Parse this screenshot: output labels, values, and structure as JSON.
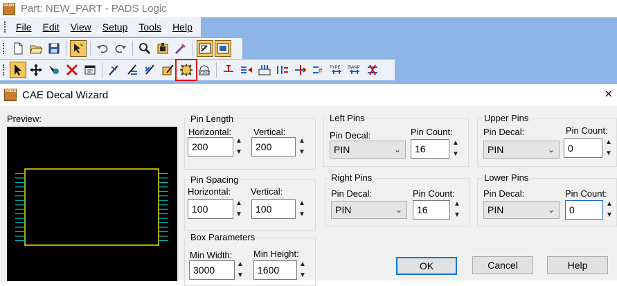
{
  "window": {
    "app_icon_text": "PADS",
    "title": "Part: NEW_PART - PADS Logic"
  },
  "menu": {
    "items": [
      "File",
      "Edit",
      "View",
      "Setup",
      "Tools",
      "Help"
    ]
  },
  "toolbar1": {
    "icons": [
      "new-icon",
      "open-icon",
      "save-icon",
      "select-mode-icon",
      "undo-icon",
      "redo-icon",
      "zoom-icon",
      "library-icon",
      "wizard-icon",
      "part-editor-icon",
      "gate-editor-icon"
    ]
  },
  "toolbar2": {
    "icons": [
      "select-arrow-icon",
      "move-icon",
      "rotate-icon",
      "delete-icon",
      "properties-icon",
      "add-2d-line-icon",
      "add-text-icon",
      "add-field-icon",
      "edit-part-icon",
      "cae-decal-wizard-icon",
      "add-cost-icon",
      "add-terminal-icon",
      "set-pin-numbers-icon",
      "renumber-icon",
      "pin-spacing-icon",
      "pin-type-icon",
      "type-icon",
      "swap-icon",
      "pin-swap-icon"
    ],
    "type_label": "TYPE",
    "swap_label": "SWAP"
  },
  "dialog": {
    "title": "CAE Decal Wizard",
    "close_glyph": "×",
    "preview_label": "Preview:",
    "pin_length": {
      "title": "Pin Length",
      "horizontal_label": "Horizontal:",
      "horizontal_value": "200",
      "vertical_label": "Vertical:",
      "vertical_value": "200"
    },
    "pin_spacing": {
      "title": "Pin Spacing",
      "horizontal_label": "Horizontal:",
      "horizontal_value": "100",
      "vertical_label": "Vertical:",
      "vertical_value": "100"
    },
    "box_parameters": {
      "title": "Box Parameters",
      "min_width_label": "Min Width:",
      "min_width_value": "3000",
      "min_height_label": "Min Height:",
      "min_height_value": "1600"
    },
    "left_pins": {
      "title": "Left Pins",
      "decal_label": "Pin Decal:",
      "decal_value": "PIN",
      "count_label": "Pin Count:",
      "count_value": "16"
    },
    "right_pins": {
      "title": "Right Pins",
      "decal_label": "Pin Decal:",
      "decal_value": "PIN",
      "count_label": "Pin Count:",
      "count_value": "16"
    },
    "upper_pins": {
      "title": "Upper Pins",
      "decal_label": "Pin Decal:",
      "decal_value": "PIN",
      "count_label": "Pin Count:",
      "count_value": "0"
    },
    "lower_pins": {
      "title": "Lower Pins",
      "decal_label": "Pin Decal:",
      "decal_value": "PIN",
      "count_label": "Pin Count:",
      "count_value": "0"
    },
    "buttons": {
      "ok": "OK",
      "cancel": "Cancel",
      "help": "Help"
    },
    "spin_up": "▲",
    "spin_down": "▼",
    "combo_arrow": "⌄"
  },
  "colors": {
    "app_background": "#8fb4e6",
    "preview_background": "#000000",
    "box_outline": "#e6e600",
    "pin_color": "#00c8c8",
    "highlight": "#e01010"
  }
}
